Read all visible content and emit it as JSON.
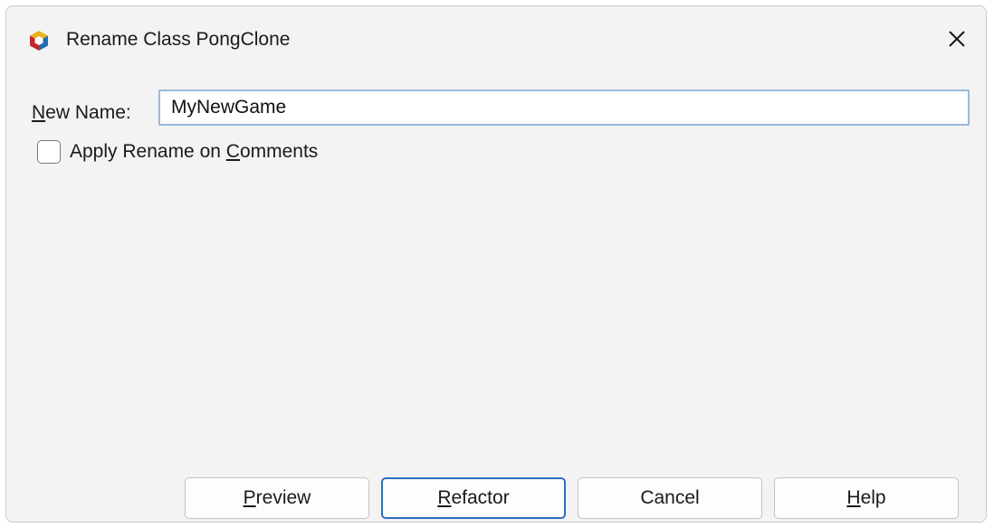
{
  "window": {
    "title": "Rename Class PongClone",
    "icon": "netbeans-cube-icon",
    "close_symbol": "✕"
  },
  "form": {
    "name_label_mnemonic": "N",
    "name_label_rest": "ew Name:",
    "name_value": "MyNewGame",
    "checkbox_checked": false,
    "checkbox_label_pre": "Apply Rename on ",
    "checkbox_label_mnemonic": "C",
    "checkbox_label_post": "omments"
  },
  "buttons": {
    "preview_mnemonic": "P",
    "preview_rest": "review",
    "refactor_mnemonic": "R",
    "refactor_rest": "efactor",
    "cancel_label": "Cancel",
    "help_mnemonic": "H",
    "help_rest": "elp"
  },
  "colors": {
    "dialog_bg": "#f3f3f3",
    "default_button_border": "#2f6fbf",
    "input_border": "#9cb9d9"
  }
}
